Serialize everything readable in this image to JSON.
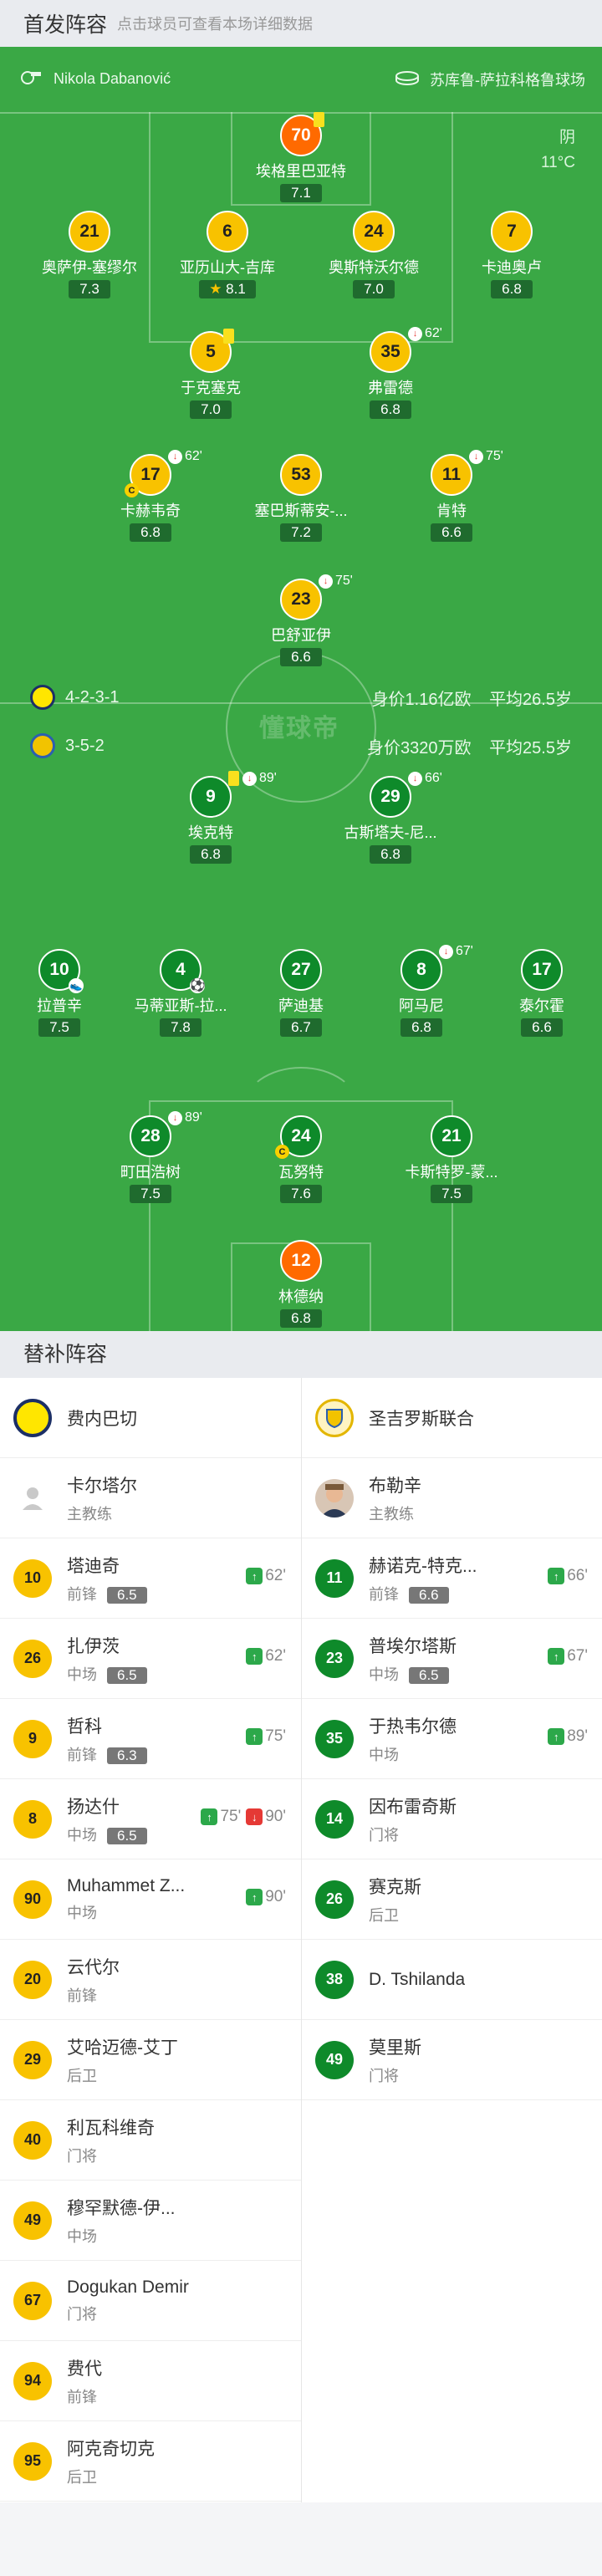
{
  "header": {
    "title": "首发阵容",
    "hint": "点击球员可查看本场详细数据"
  },
  "match_info": {
    "referee": "Nikola Dabanović",
    "venue": "苏库鲁-萨拉科格鲁球场",
    "weather": "阴",
    "temperature": "11°C"
  },
  "watermark": "懂球帝",
  "away_team": {
    "formation": "4-2-3-1",
    "value": "身价1.16亿欧",
    "avg_age": "平均26.5岁"
  },
  "home_team": {
    "formation": "3-5-2",
    "value": "身价3320万欧",
    "avg_age": "平均25.5岁"
  },
  "away_players": [
    {
      "num": "70",
      "name": "埃格里巴亚特",
      "rating": "7.1",
      "color": "orange",
      "yellow": true
    },
    {
      "num": "21",
      "name": "奥萨伊-塞缪尔",
      "rating": "7.3",
      "color": "yellow"
    },
    {
      "num": "6",
      "name": "亚历山大-吉库",
      "rating": "8.1",
      "color": "yellow",
      "star": true
    },
    {
      "num": "24",
      "name": "奥斯特沃尔德",
      "rating": "7.0",
      "color": "yellow"
    },
    {
      "num": "7",
      "name": "卡迪奥卢",
      "rating": "6.8",
      "color": "yellow"
    },
    {
      "num": "5",
      "name": "于克塞克",
      "rating": "7.0",
      "color": "yellow",
      "yellow": true
    },
    {
      "num": "35",
      "name": "弗雷德",
      "rating": "6.8",
      "color": "yellow",
      "sub_min": "62'"
    },
    {
      "num": "17",
      "name": "卡赫韦奇",
      "rating": "6.8",
      "color": "yellow",
      "sub_min": "62'",
      "captain": true
    },
    {
      "num": "53",
      "name": "塞巴斯蒂安-...",
      "rating": "7.2",
      "color": "yellow"
    },
    {
      "num": "11",
      "name": "肯特",
      "rating": "6.6",
      "color": "yellow",
      "sub_min": "75'"
    },
    {
      "num": "23",
      "name": "巴舒亚伊",
      "rating": "6.6",
      "color": "yellow",
      "sub_min": "75'"
    }
  ],
  "home_players": [
    {
      "num": "9",
      "name": "埃克特",
      "rating": "6.8",
      "color": "green",
      "yellow": true,
      "sub_min": "89'"
    },
    {
      "num": "29",
      "name": "古斯塔夫-尼...",
      "rating": "6.8",
      "color": "green",
      "sub_min": "66'"
    },
    {
      "num": "10",
      "name": "拉普辛",
      "rating": "7.5",
      "color": "green",
      "assist": true
    },
    {
      "num": "4",
      "name": "马蒂亚斯-拉...",
      "rating": "7.8",
      "color": "green",
      "goal": true
    },
    {
      "num": "27",
      "name": "萨迪基",
      "rating": "6.7",
      "color": "green"
    },
    {
      "num": "8",
      "name": "阿马尼",
      "rating": "6.8",
      "color": "green",
      "sub_min": "67'"
    },
    {
      "num": "17",
      "name": "泰尔霍",
      "rating": "6.6",
      "color": "green"
    },
    {
      "num": "28",
      "name": "町田浩树",
      "rating": "7.5",
      "color": "green",
      "sub_min": "89'"
    },
    {
      "num": "24",
      "name": "瓦努特",
      "rating": "7.6",
      "color": "green",
      "captain": true
    },
    {
      "num": "21",
      "name": "卡斯特罗-蒙...",
      "rating": "7.5",
      "color": "green"
    },
    {
      "num": "12",
      "name": "林德纳",
      "rating": "6.8",
      "color": "orange"
    }
  ],
  "subs_header": "替补阵容",
  "left_team": {
    "name": "费内巴切",
    "coach": {
      "name": "卡尔塔尔",
      "role": "主教练"
    },
    "subs": [
      {
        "num": "10",
        "name": "塔迪奇",
        "pos": "前锋",
        "rating": "6.5",
        "on": "62'"
      },
      {
        "num": "26",
        "name": "扎伊茨",
        "pos": "中场",
        "rating": "6.5",
        "on": "62'"
      },
      {
        "num": "9",
        "name": "哲科",
        "pos": "前锋",
        "rating": "6.3",
        "on": "75'"
      },
      {
        "num": "8",
        "name": "扬达什",
        "pos": "中场",
        "rating": "6.5",
        "on": "75'",
        "off": "90'"
      },
      {
        "num": "90",
        "name": "Muhammet Z...",
        "pos": "中场",
        "on": "90'"
      },
      {
        "num": "20",
        "name": "云代尔",
        "pos": "前锋"
      },
      {
        "num": "29",
        "name": "艾哈迈德-艾丁",
        "pos": "后卫"
      },
      {
        "num": "40",
        "name": "利瓦科维奇",
        "pos": "门将"
      },
      {
        "num": "49",
        "name": "穆罕默德-伊...",
        "pos": "中场"
      },
      {
        "num": "67",
        "name": "Dogukan Demir",
        "pos": "门将"
      },
      {
        "num": "94",
        "name": "费代",
        "pos": "前锋"
      },
      {
        "num": "95",
        "name": "阿克奇切克",
        "pos": "后卫"
      }
    ]
  },
  "right_team": {
    "name": "圣吉罗斯联合",
    "coach": {
      "name": "布勒辛",
      "role": "主教练"
    },
    "subs": [
      {
        "num": "11",
        "name": "赫诺克-特克...",
        "pos": "前锋",
        "rating": "6.6",
        "on": "66'"
      },
      {
        "num": "23",
        "name": "普埃尔塔斯",
        "pos": "中场",
        "rating": "6.5",
        "on": "67'"
      },
      {
        "num": "35",
        "name": "于热韦尔德",
        "pos": "中场",
        "on": "89'"
      },
      {
        "num": "14",
        "name": "因布雷奇斯",
        "pos": "门将"
      },
      {
        "num": "26",
        "name": "赛克斯",
        "pos": "后卫"
      },
      {
        "num": "38",
        "name": "D. Tshilanda",
        "pos": ""
      },
      {
        "num": "49",
        "name": "莫里斯",
        "pos": "门将"
      }
    ]
  },
  "colors": {
    "pitch": "#3aa845",
    "away": "#f8c200",
    "home": "#0e8a2a",
    "gk": "#ff6a00"
  }
}
